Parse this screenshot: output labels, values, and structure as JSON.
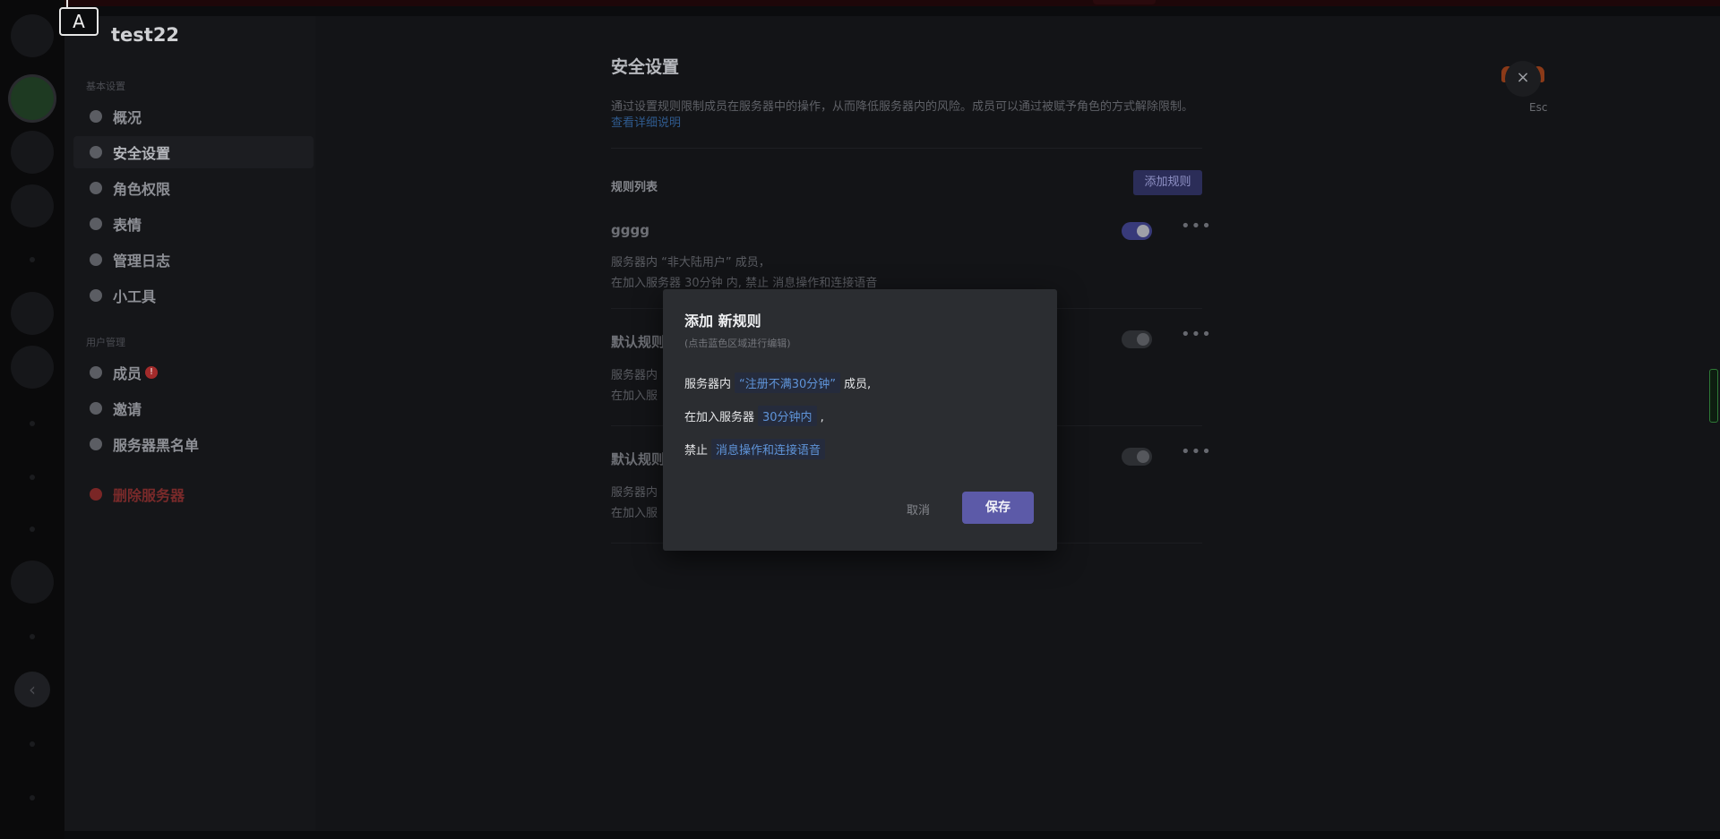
{
  "guild": {
    "name": "test22"
  },
  "keyboard_hint": "A",
  "sidebar": {
    "section_basic": "基本设置",
    "section_users": "用户管理",
    "items": [
      {
        "label": "概况",
        "icon": "gear-icon"
      },
      {
        "label": "安全设置",
        "icon": "shield-icon"
      },
      {
        "label": "角色权限",
        "icon": "user-role-icon"
      },
      {
        "label": "表情",
        "icon": "emoji-icon"
      },
      {
        "label": "管理日志",
        "icon": "log-icon"
      },
      {
        "label": "小工具",
        "icon": "wrench-icon"
      },
      {
        "label": "成员",
        "icon": "members-icon",
        "badge": "!"
      },
      {
        "label": "邀请",
        "icon": "invite-icon"
      },
      {
        "label": "服务器黑名单",
        "icon": "ban-icon"
      },
      {
        "label": "删除服务器",
        "icon": "delete-icon"
      }
    ]
  },
  "main": {
    "title": "安全设置",
    "description": "通过设置规则限制成员在服务器中的操作，从而降低服务器内的风险。成员可以通过被赋予角色的方式解除限制。",
    "details_link": "查看详细说明",
    "rules_list_title": "规则列表",
    "add_rule_label": "添加规则",
    "rules": [
      {
        "name": "gggg",
        "line1": "服务器内 “非大陆用户” 成员，",
        "line2": "在加入服务器 30分钟 内, 禁止 消息操作和连接语音",
        "enabled": true
      },
      {
        "name": "默认规则",
        "line1": "服务器内",
        "line2": "在加入服",
        "enabled": false
      },
      {
        "name": "默认规则",
        "line1": "服务器内",
        "line2": "在加入服",
        "enabled": false
      }
    ]
  },
  "esc": {
    "label": "Esc",
    "close_glyph": "×"
  },
  "modal": {
    "title": "添加 新规则",
    "hint": "(点击蓝色区域进行编辑)",
    "line1_prefix": "服务器内",
    "line1_chip": "“注册不满30分钟”",
    "line1_suffix": "成员,",
    "line2_prefix": "在加入服务器",
    "line2_chip": "30分钟内",
    "line2_suffix": ",",
    "line3_prefix": "禁止",
    "line3_chip": "消息操作和连接语音",
    "cancel_label": "取消",
    "save_label": "保存"
  },
  "colors": {
    "accent": "#5c5aa8",
    "link": "#5f94d9",
    "danger": "#a32b2b"
  }
}
